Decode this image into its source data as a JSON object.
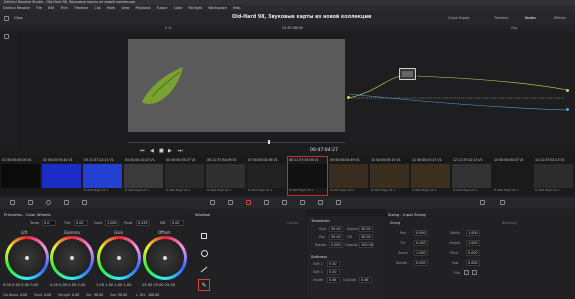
{
  "window": {
    "title": "DaVinci Resolve Studio - Old-Hard 98, Звуковые карты из новой коллекции"
  },
  "menu": [
    "DaVinci Resolve",
    "File",
    "Edit",
    "Trim",
    "Timeline",
    "Clip",
    "Mark",
    "View",
    "Playback",
    "Fusion",
    "Color",
    "Fairlight",
    "Workspace",
    "Help"
  ],
  "toolbar": {
    "clips_label": "Clips",
    "project_title": "Old-Hard 98, Звуковые карты из новой коллекции",
    "quick_export": "Quick Export",
    "timeline_label": "Timeline",
    "nodes_label": "Nodes",
    "effects_label": "Effects"
  },
  "viewer": {
    "zoom": "0 %",
    "timecode_top": "21:37:30:09",
    "timecode": "00:47:04:27",
    "clip_menu": "Clip"
  },
  "clips": [
    {
      "num": "01",
      "tc": "00:00:00:00",
      "v": "V1",
      "codec": ""
    },
    {
      "num": "02",
      "tc": "00:05:59:40",
      "v": "V1",
      "codec": ""
    },
    {
      "num": "03",
      "tc": "21:37:22:11",
      "v": "V1",
      "codec": "H.264 High L5.1"
    },
    {
      "num": "04",
      "tc": "00:00:10:23",
      "v": "V1",
      "codec": "H.264 High L5.1"
    },
    {
      "num": "05",
      "tc": "00:00:35:27",
      "v": "V1",
      "codec": "H.264 High L5.1"
    },
    {
      "num": "06",
      "tc": "21:37:34:09",
      "v": "V1",
      "codec": "H.264 High L5.1"
    },
    {
      "num": "07",
      "tc": "00:00:04:36",
      "v": "V1",
      "codec": "H.264 High L5.1"
    },
    {
      "num": "08",
      "tc": "21:37:34:09",
      "v": "V1",
      "codec": "H.264 High L5.1"
    },
    {
      "num": "09",
      "tc": "00:00:04:49",
      "v": "V1",
      "codec": "H.264 High L5.1"
    },
    {
      "num": "10",
      "tc": "00:00:05:15",
      "v": "V1",
      "codec": "H.264 High L5.1"
    },
    {
      "num": "11",
      "tc": "00:00:07:47",
      "v": "V1",
      "codec": "H.264 High L5.1"
    },
    {
      "num": "12",
      "tc": "21:37:02:13",
      "v": "V1",
      "codec": "H.264 High L5.1"
    },
    {
      "num": "13",
      "tc": "00:00:00:07",
      "v": "V1",
      "codec": "H.264 High L5.1"
    },
    {
      "num": "14",
      "tc": "21:37:02:13",
      "v": "V1",
      "codec": "H.264 High L5.1"
    }
  ],
  "primaries": {
    "title": "Primaries - Color Wheels",
    "temp_label": "Temp",
    "temp": "0.0",
    "tint_label": "Tint",
    "tint": "0.00",
    "cont_label": "Cont",
    "cont": "1.000",
    "pivot_label": "Pivot",
    "pivot": "0.435",
    "md_label": "MD",
    "md": "0.00",
    "wheels": [
      {
        "name": "Lift",
        "vals": "0.00  0.00  0.00  0.00"
      },
      {
        "name": "Gamma",
        "vals": "0.00  0.00  0.00  0.00"
      },
      {
        "name": "Gain",
        "vals": "1.00  1.00  1.00  1.00"
      },
      {
        "name": "Offset",
        "vals": "25.00  25.00  25.00"
      }
    ],
    "bottom": {
      "cb_label": "Col Boost",
      "cb": "0.00",
      "shad_label": "Shad",
      "shad": "0.00",
      "hl_label": "Hi/Light",
      "hl": "0.00",
      "sat_label": "Sat",
      "sat": "50.00",
      "hue_label": "Hue",
      "hue": "50.00",
      "lmix_label": "L. Mix",
      "lmix": "100.00"
    }
  },
  "window_panel": {
    "title": "Window",
    "curves_label": "Curves"
  },
  "transform": {
    "title": "Transform",
    "size_label": "Size",
    "size": "50.00",
    "aspect_label": "Aspect",
    "aspect": "50.00",
    "pan_label": "Pan",
    "pan": "50.00",
    "tilt_label": "Tilt",
    "tilt": "50.00",
    "rotate_label": "Rotate",
    "rotate": "0.000",
    "opacity_label": "Opacity",
    "opacity": "100.00"
  },
  "softness": {
    "title": "Softness",
    "soft1_label": "Soft 1",
    "soft1": "0.00",
    "soft2_label": "Soft 2",
    "soft2": "0.00",
    "inside_label": "Inside",
    "inside": "0.46",
    "outside_label": "Outside",
    "outside": "0.46"
  },
  "sizing": {
    "title": "Sizing - Input Sizing",
    "sub": "Sizing",
    "pan_label": "Pan",
    "pan": "0.000",
    "tilt_label": "Tilt",
    "tilt": "0.000",
    "zoom_label": "Zoom",
    "zoom": "1.000",
    "rotate_label": "Rotate",
    "rotate": "0.000",
    "width_label": "Width",
    "width": "1.000",
    "height_label": "Height",
    "height": "1.000",
    "pitch_label": "Pitch",
    "pitch": "0.000",
    "yaw_label": "Yaw",
    "yaw": "0.000",
    "flip_label": "Flip",
    "blanking_label": "Blanking"
  },
  "colors": {
    "accent": "#e03a3a",
    "playhead": "#ffffff",
    "clip_selected": "#c63030"
  }
}
